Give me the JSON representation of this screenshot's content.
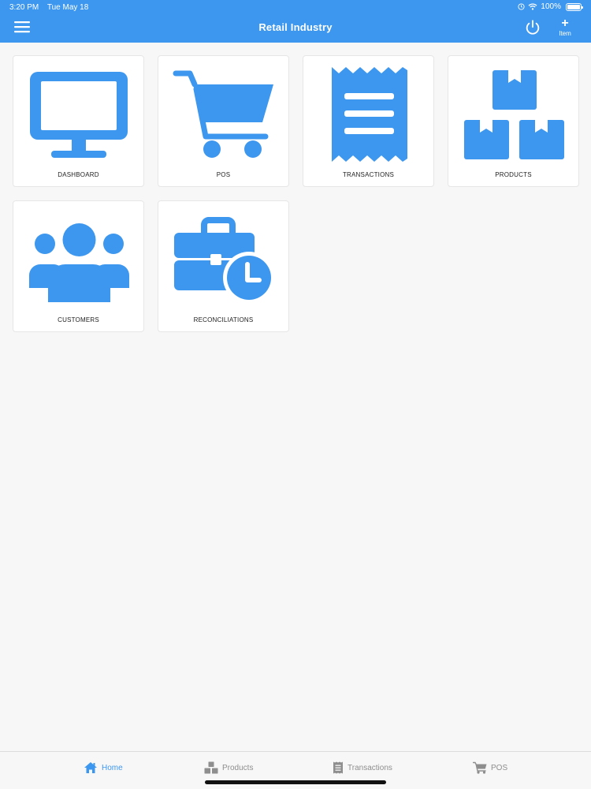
{
  "status_bar": {
    "time": "3:20 PM",
    "date": "Tue May 18",
    "battery": "100%"
  },
  "nav": {
    "title": "Retail Industry",
    "add_item_label": "Item",
    "add_symbol": "+"
  },
  "tiles": [
    {
      "label": "DASHBOARD",
      "icon": "monitor-icon"
    },
    {
      "label": "POS",
      "icon": "shopping-cart-icon"
    },
    {
      "label": "TRANSACTIONS",
      "icon": "receipt-icon"
    },
    {
      "label": "PRODUCTS",
      "icon": "boxes-icon"
    },
    {
      "label": "CUSTOMERS",
      "icon": "users-group-icon"
    },
    {
      "label": "RECONCILIATIONS",
      "icon": "briefcase-clock-icon"
    }
  ],
  "tab_bar": {
    "items": [
      {
        "label": "Home",
        "icon": "home-icon",
        "active": true
      },
      {
        "label": "Products",
        "icon": "boxes-icon",
        "active": false
      },
      {
        "label": "Transactions",
        "icon": "receipt-icon",
        "active": false
      },
      {
        "label": "POS",
        "icon": "shopping-cart-icon",
        "active": false
      }
    ]
  },
  "colors": {
    "accent": "#3d97ee",
    "background": "#f7f7f7",
    "tile_background": "#ffffff",
    "inactive_tab": "#8e8e8e"
  }
}
